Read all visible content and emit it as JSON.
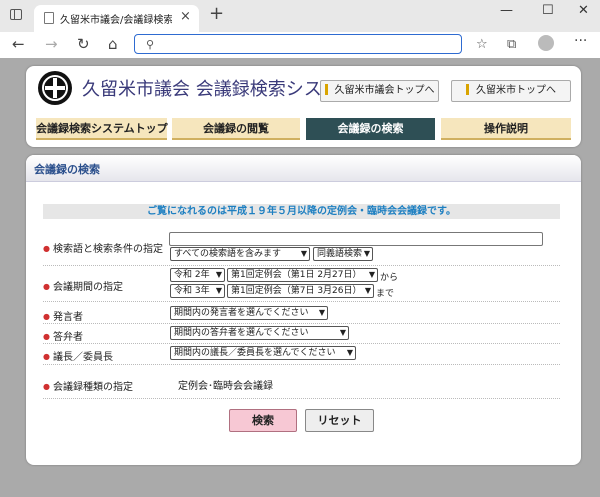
{
  "browser": {
    "tab_title": "久留米市議会/会議録検索システム",
    "tab_close": "×",
    "new_tab": "+",
    "window_controls": {
      "minimize": "—",
      "maximize": "☐",
      "close": "✕"
    },
    "nav": {
      "back": "←",
      "forward": "→",
      "reload": "↻",
      "home": "⌂"
    },
    "url_value": "",
    "search_icon": "⚲",
    "toolbar": {
      "favorites": "☆",
      "collections": "⧉",
      "more": "···"
    }
  },
  "header": {
    "site_title": "久留米市議会 会議録検索システム",
    "top_links": [
      "久留米市議会トップへ",
      "久留米市トップへ"
    ],
    "tabs": [
      "会議録検索システムトップ",
      "会議録の閲覧",
      "会議録の検索",
      "操作説明"
    ],
    "active_tab": 2
  },
  "search": {
    "section_title": "会議録の検索",
    "notice": "ご覧になれるのは平成１９年５月以降の定例会・臨時会会議録です。",
    "rows": {
      "keyword": {
        "label": "検索語と検索条件の指定",
        "input_value": "",
        "condition": "すべての検索語を含みます",
        "synonym": "同義語検索"
      },
      "period": {
        "label": "会議期間の指定",
        "from_year": "令和 2年",
        "from_session": "第1回定例会（第1日 2月27日）",
        "from_suffix": "から",
        "to_year": "令和 3年",
        "to_session": "第1回定例会（第7日 3月26日）",
        "to_suffix": "まで"
      },
      "speaker": {
        "label": "発言者",
        "value": "期間内の発言者を選んでください"
      },
      "answerer": {
        "label": "答弁者",
        "value": "期間内の答弁者を選んでください"
      },
      "chair": {
        "label": "議長／委員長",
        "value": "期間内の議長／委員長を選んでください"
      },
      "type": {
        "label": "会議録種類の指定",
        "value": "定例会･臨時会会議録"
      }
    },
    "buttons": {
      "search": "検索",
      "reset": "リセット"
    }
  },
  "colors": {
    "url_border": "#2e6bd1",
    "active_tab_bg": "#2e4f55",
    "inactive_tab_bg": "#f6e6bd",
    "section_title": "#2a4f8c",
    "notice_text": "#1d7fc1",
    "search_button": "#f7c8d4"
  }
}
